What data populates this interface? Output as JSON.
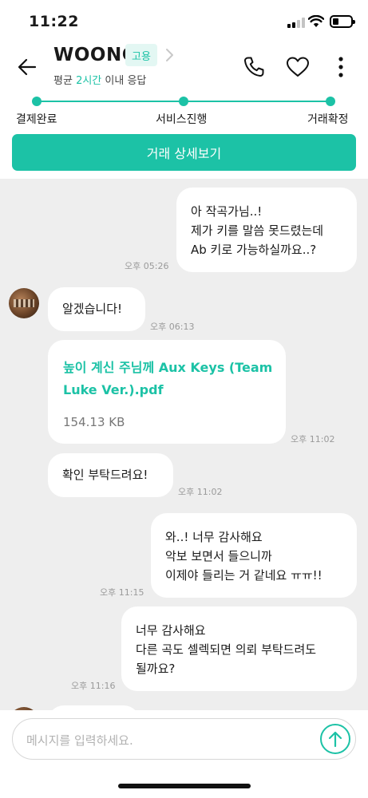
{
  "status_bar": {
    "time": "11:22",
    "battery_level": 0.3
  },
  "header": {
    "seller_name": "WOONG",
    "badge": "고용",
    "response_prefix": "평균",
    "response_time": "2시간",
    "response_suffix": "이내 응답"
  },
  "progress": {
    "steps": [
      "결제완료",
      "서비스진행",
      "거래확정"
    ],
    "current_step": 3
  },
  "detail_button_label": "거래 상세보기",
  "messages": [
    {
      "side": "sent",
      "lines": [
        "아 작곡가님..!",
        "제가 키를 말씀 못드렸는데",
        "Ab 키로 가능하실까요..?"
      ],
      "time": "오후 05:26"
    },
    {
      "side": "received",
      "lines": [
        "알겠습니다!"
      ],
      "time": "오후 06:13"
    },
    {
      "side": "received",
      "type": "file",
      "file_lines": [
        "높이 계신 주님께 Aux Keys (Team",
        "Luke Ver.).pdf"
      ],
      "file_size": "154.13 KB",
      "time": "오후 11:02"
    },
    {
      "side": "received",
      "lines": [
        "확인 부탁드려요!"
      ],
      "time": "오후 11:02"
    },
    {
      "side": "sent",
      "lines": [
        "와..! 너무 감사해요",
        "악보 보면서 들으니까",
        "이제야 들리는 거 같네요 ㅠㅠ!!"
      ],
      "time": "오후 11:15"
    },
    {
      "side": "sent",
      "lines": [
        "너무 감사해요",
        "다른 곡도 셀렉되면 의뢰 부탁드려도",
        "될까요?"
      ],
      "time": "오후 11:16"
    }
  ],
  "input": {
    "placeholder": "메시지를 입력하세요."
  },
  "colors": {
    "accent": "#1cc2a6",
    "chat_background": "#eeeeee",
    "badge_background": "#e3f7f3"
  }
}
